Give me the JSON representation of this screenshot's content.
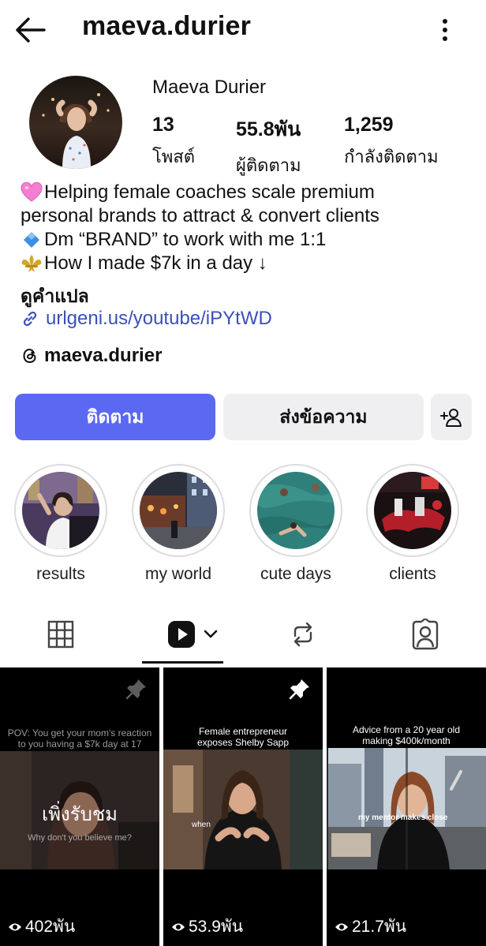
{
  "header": {
    "username": "maeva.durier",
    "back_icon": "arrow-left-icon",
    "more_icon": "vertical-dots-icon"
  },
  "profile": {
    "full_name": "Maeva Durier",
    "stats": {
      "posts": {
        "value": "13",
        "label": "โพสต์"
      },
      "followers": {
        "value": "55.8พัน",
        "label": "ผู้ติดตาม"
      },
      "following": {
        "value": "1,259",
        "label": "กำลังติดตาม"
      }
    },
    "bio": [
      {
        "emoji": "pink-heart-icon",
        "text": "Helping female coaches scale premium"
      },
      {
        "emoji": "",
        "text": "personal brands to attract & convert clients"
      },
      {
        "emoji": "blue-diamond-icon",
        "text": "Dm “BRAND” to work with me 1:1"
      },
      {
        "emoji": "fleur-de-lis-icon",
        "text": "How I made $7k in a day ↓"
      }
    ],
    "translate_label": "ดูคำแปล",
    "link": "urlgeni.us/youtube/iPYtWD",
    "threads_handle": "maeva.durier"
  },
  "actions": {
    "follow_label": "ติดตาม",
    "message_label": "ส่งข้อความ",
    "add_icon": "add-person-icon",
    "follow_color": "#5a68f2"
  },
  "highlights": [
    {
      "label": "results"
    },
    {
      "label": "my world"
    },
    {
      "label": "cute days"
    },
    {
      "label": "clients"
    }
  ],
  "tabs": [
    {
      "name": "grid",
      "icon": "grid-icon"
    },
    {
      "name": "reels",
      "icon": "reels-icon",
      "selected": true
    },
    {
      "name": "reposts",
      "icon": "repost-icon"
    },
    {
      "name": "tagged",
      "icon": "tagged-person-icon"
    }
  ],
  "reels": [
    {
      "pinned": true,
      "caption": "POV: You get your mom's reaction to you having a $7k day at 17",
      "overlay": "เพิ่งรับชม",
      "subtitle": "Why don't you believe me?",
      "views": "402พัน"
    },
    {
      "pinned": true,
      "caption": "Female entrepreneur exposes Shelby Sapp",
      "overlay": "when",
      "subtitle": "",
      "views": "53.9พัน"
    },
    {
      "pinned": false,
      "caption": "Advice from a 20 year old making $400k/month",
      "overlay": "my mentor makes close",
      "subtitle": "",
      "views": "21.7พัน"
    }
  ]
}
